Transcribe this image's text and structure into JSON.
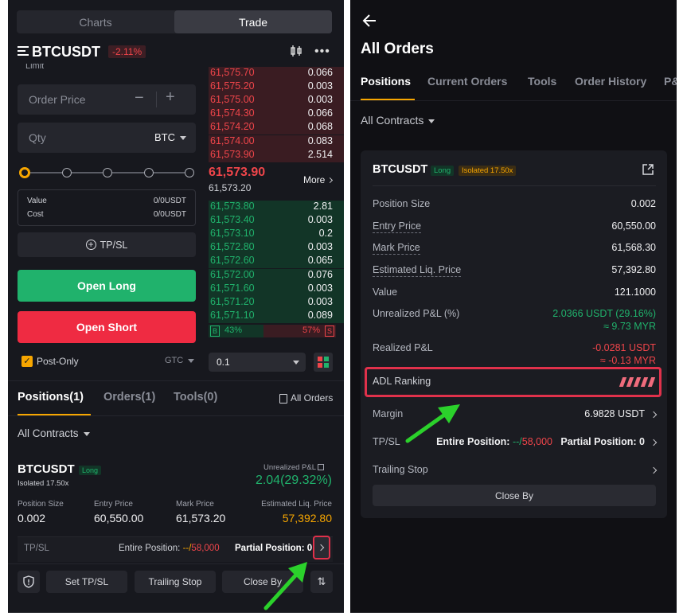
{
  "left": {
    "tabs": {
      "charts": "Charts",
      "trade": "Trade"
    },
    "symbol": "BTCUSDT",
    "change": "-2.11%",
    "order_type": "Limit",
    "order_price_placeholder": "Order Price",
    "qty_placeholder": "Qty",
    "qty_unit": "BTC",
    "slider_level": 0,
    "value_label": "Value",
    "value_text": "0/0USDT",
    "cost_label": "Cost",
    "cost_text": "0/0USDT",
    "tpsl_label": "TP/SL",
    "open_long": "Open Long",
    "open_short": "Open Short",
    "post_only": "Post-Only",
    "gtc": "GTC",
    "asks": [
      [
        "61,575.70",
        "0.066"
      ],
      [
        "61,575.20",
        "0.003"
      ],
      [
        "61,575.00",
        "0.003"
      ],
      [
        "61,574.30",
        "0.066"
      ],
      [
        "61,574.20",
        "0.068"
      ],
      [
        "61,574.00",
        "0.083"
      ],
      [
        "61,573.90",
        "2.514"
      ]
    ],
    "mid_price": "61,573.90",
    "mark_price": "61,573.20",
    "more": "More",
    "bids": [
      [
        "61,573.80",
        "2.81"
      ],
      [
        "61,573.40",
        "0.003"
      ],
      [
        "61,573.10",
        "0.2"
      ],
      [
        "61,572.80",
        "0.003"
      ],
      [
        "61,572.60",
        "0.065"
      ],
      [
        "61,572.00",
        "0.076"
      ],
      [
        "61,571.60",
        "0.003"
      ],
      [
        "61,571.20",
        "0.003"
      ],
      [
        "61,571.10",
        "0.089"
      ]
    ],
    "buy_tag": "B",
    "buy_pct": "43%",
    "sell_pct": "57%",
    "sell_tag": "S",
    "depth_value": "0.1",
    "tabs2": {
      "positions": "Positions(1)",
      "orders": "Orders(1)",
      "tools": "Tools(0)",
      "all_orders": "All Orders"
    },
    "all_contracts": "All Contracts",
    "pos": {
      "symbol": "BTCUSDT",
      "side": "Long",
      "mode": "Isolated 17.50x",
      "upnl_label": "Unrealized P&L",
      "upnl": "2.04(29.32%)",
      "size_label": "Position Size",
      "size": "0.002",
      "entry_label": "Entry Price",
      "entry": "60,550.00",
      "mark_label": "Mark Price",
      "mark": "61,573.20",
      "liq_label": "Estimated Liq. Price",
      "liq": "57,392.80",
      "tpsl_label": "TP/SL",
      "entire_label": "Entire Position:",
      "entire_dash": "--/",
      "entire_val": "58,000",
      "partial": "Partial Position: 0"
    },
    "actions": {
      "set_tpsl": "Set TP/SL",
      "trailing": "Trailing Stop",
      "close_by": "Close By"
    }
  },
  "right": {
    "title": "All Orders",
    "tabs": [
      "Positions",
      "Current Orders",
      "Tools",
      "Order History",
      "P&"
    ],
    "all_contracts": "All Contracts",
    "card": {
      "symbol": "BTCUSDT",
      "side": "Long",
      "mode": "Isolated 17.50x",
      "rows": [
        {
          "k": "Position Size",
          "v": "0.002"
        },
        {
          "k": "Entry Price",
          "v": "60,550.00"
        },
        {
          "k": "Mark Price",
          "v": "61,568.30"
        },
        {
          "k": "Estimated Liq. Price",
          "v": "57,392.80"
        },
        {
          "k": "Value",
          "v": "121.1000"
        }
      ],
      "upnl_label": "Unrealized P&L (%)",
      "upnl": "2.0366 USDT (29.16%)",
      "upnl_myr": "≈ 9.73 MYR",
      "rpnl_label": "Realized P&L",
      "rpnl": "-0.0281 USDT",
      "rpnl_myr": "≈ -0.13 MYR",
      "adl_label": "ADL Ranking",
      "adl_level": 5,
      "margin_label": "Margin",
      "margin": "6.9828 USDT",
      "tpsl_label": "TP/SL",
      "entire_label": "Entire Position:",
      "entire_dash": "--/",
      "entire_val": "58,000",
      "partial": "Partial Position: 0",
      "trailing": "Trailing Stop",
      "close_by": "Close By"
    }
  },
  "colors": {
    "green": "#20b26c",
    "red": "#ef454a",
    "orange": "#f7a600",
    "highlight": "#e0314b",
    "arrow": "#2bd12b"
  }
}
